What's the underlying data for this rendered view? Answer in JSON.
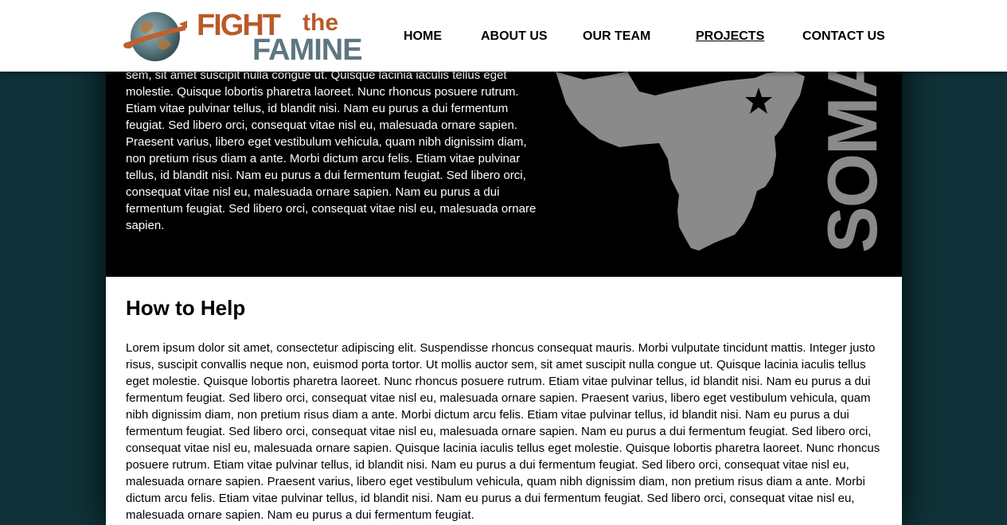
{
  "header": {
    "logo": {
      "line1": "FIGHT",
      "line1_small": "the",
      "line2": "FAMINE"
    },
    "nav": [
      {
        "label": "HOME",
        "active": false
      },
      {
        "label": "ABOUT US",
        "active": false
      },
      {
        "label": "OUR TEAM",
        "active": false
      },
      {
        "label": "PROJECTS",
        "active": true
      },
      {
        "label": "CONTACT US",
        "active": false
      }
    ]
  },
  "hero": {
    "text": "sem, sit amet suscipit nulla congue ut. Quisque lacinia iaculis tellus eget molestie. Quisque lobortis pharetra laoreet. Nunc rhoncus posuere rutrum. Etiam vitae pulvinar tellus, id blandit nisi. Nam eu purus a dui fermentum feugiat. Sed libero orci, consequat vitae nisl eu, malesuada ornare sapien. Praesent varius, libero eget vestibulum vehicula, quam nibh dignissim diam, non pretium risus diam a ante. Morbi dictum arcu felis. Etiam vitae pulvinar tellus, id blandit nisi. Nam eu purus a dui fermentum feugiat. Sed libero orci, consequat vitae nisl eu, malesuada ornare sapien. Nam eu purus a dui fermentum feugiat. Sed libero orci, consequat vitae nisl eu, malesuada ornare sapien.",
    "country_label": "SOMA"
  },
  "content": {
    "heading": "How to Help",
    "body": "Lorem ipsum dolor sit amet, consectetur adipiscing elit. Suspendisse rhoncus consequat mauris. Morbi vulputate tincidunt mattis. Integer justo risus, suscipit convallis neque non, euismod porta tortor. Ut mollis auctor sem, sit amet suscipit nulla congue ut. Quisque lacinia iaculis tellus eget molestie. Quisque lobortis pharetra laoreet. Nunc rhoncus posuere rutrum. Etiam vitae pulvinar tellus, id blandit nisi. Nam eu purus a dui fermentum feugiat. Sed libero orci, consequat vitae nisl eu, malesuada ornare sapien. Praesent varius, libero eget vestibulum vehicula, quam nibh dignissim diam, non pretium risus diam a ante. Morbi dictum arcu felis. Etiam vitae pulvinar tellus, id blandit nisi. Nam eu purus a dui fermentum feugiat. Sed libero orci, consequat vitae nisl eu, malesuada ornare sapien. Nam eu purus a dui fermentum feugiat. Sed libero orci, consequat vitae nisl eu, malesuada ornare sapien. Quisque lacinia iaculis tellus eget molestie. Quisque lobortis pharetra laoreet. Nunc rhoncus posuere rutrum. Etiam vitae pulvinar tellus, id blandit nisi. Nam eu purus a dui fermentum feugiat. Sed libero orci, consequat vitae nisl eu, malesuada ornare sapien. Praesent varius, libero eget vestibulum vehicula, quam nibh dignissim diam, non pretium risus diam a ante. Morbi dictum arcu felis. Etiam vitae pulvinar tellus, id blandit nisi. Nam eu purus a dui fermentum feugiat. Sed libero orci, consequat vitae nisl eu, malesuada ornare sapien. Nam eu purus a dui fermentum feugiat."
  },
  "colors": {
    "background": "#0f3238",
    "hero_background": "#000000",
    "map_fill": "#8a8a8a",
    "logo_orange": "#b95a2a",
    "logo_slate": "#5e7680"
  },
  "icons": {
    "logo": "globe-with-cutlery-icon",
    "map": "africa-map-icon",
    "marker": "star-marker-icon"
  }
}
